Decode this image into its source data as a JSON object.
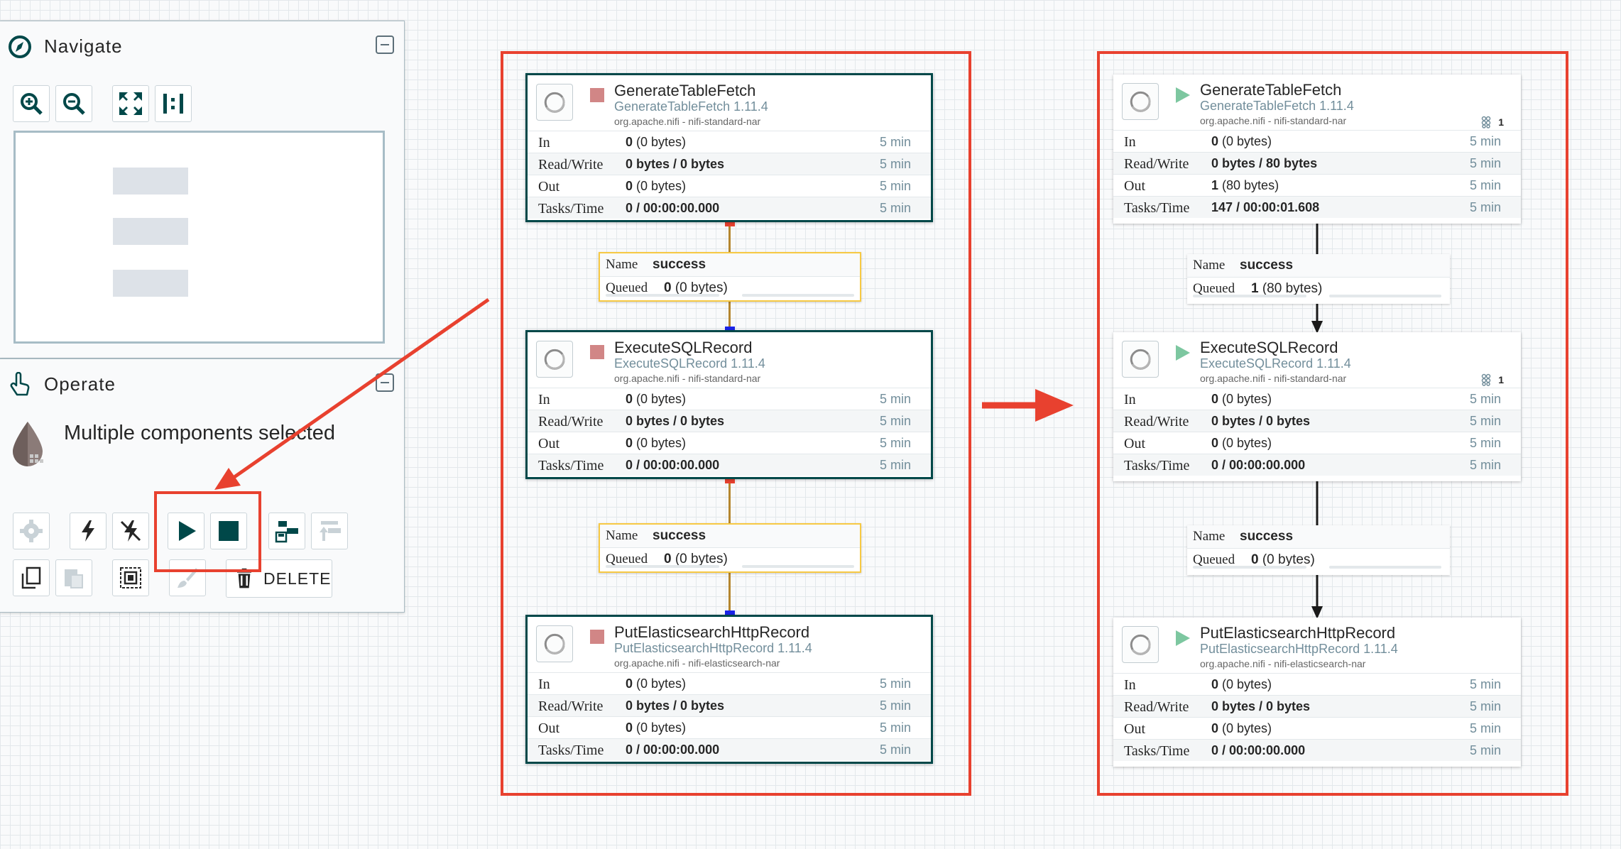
{
  "navigate": {
    "title": "Navigate"
  },
  "operate": {
    "title": "Operate",
    "selection_text": "Multiple components selected",
    "delete_label": "DELETE"
  },
  "icons": {
    "navigate": "compass-icon",
    "zoom_in": "zoom-in-icon",
    "zoom_out": "zoom-out-icon",
    "fit": "fit-screen-icon",
    "actual_size": "actual-size-icon",
    "operate": "pointer-hand-icon",
    "configure": "gear-icon",
    "enable": "lightning-icon",
    "disable": "lightning-off-icon",
    "start": "play-icon",
    "stop": "stop-icon",
    "template_create": "template-save-icon",
    "template_upload": "template-upload-icon",
    "copy": "copy-icon",
    "paste": "paste-icon",
    "group": "group-icon",
    "color": "paint-brush-icon",
    "delete": "trash-icon"
  },
  "colors": {
    "accent_red": "#e8412f",
    "selection_border": "#004849",
    "running_green": "#7dc7a0",
    "stopped_red": "#d18686",
    "label_border": "#f7c943"
  },
  "left_flow": {
    "processors": [
      {
        "name": "GenerateTableFetch",
        "type": "GenerateTableFetch 1.11.4",
        "bundle": "org.apache.nifi - nifi-standard-nar",
        "state": "stopped",
        "in_count": "0",
        "in_size": "(0 bytes)",
        "in_time": "5 min",
        "rw": "0 bytes / 0 bytes",
        "rw_time": "5 min",
        "out_count": "0",
        "out_size": "(0 bytes)",
        "out_time": "5 min",
        "tasks": "0 / 00:00:00.000",
        "tasks_time": "5 min"
      },
      {
        "name": "ExecuteSQLRecord",
        "type": "ExecuteSQLRecord 1.11.4",
        "bundle": "org.apache.nifi - nifi-standard-nar",
        "state": "stopped",
        "in_count": "0",
        "in_size": "(0 bytes)",
        "in_time": "5 min",
        "rw": "0 bytes / 0 bytes",
        "rw_time": "5 min",
        "out_count": "0",
        "out_size": "(0 bytes)",
        "out_time": "5 min",
        "tasks": "0 / 00:00:00.000",
        "tasks_time": "5 min"
      },
      {
        "name": "PutElasticsearchHttpRecord",
        "type": "PutElasticsearchHttpRecord 1.11.4",
        "bundle": "org.apache.nifi - nifi-elasticsearch-nar",
        "state": "stopped",
        "in_count": "0",
        "in_size": "(0 bytes)",
        "in_time": "5 min",
        "rw": "0 bytes / 0 bytes",
        "rw_time": "5 min",
        "out_count": "0",
        "out_size": "(0 bytes)",
        "out_time": "5 min",
        "tasks": "0 / 00:00:00.000",
        "tasks_time": "5 min"
      }
    ],
    "connections": [
      {
        "name_label": "Name",
        "name": "success",
        "queued_label": "Queued",
        "queued_count": "0",
        "queued_size": "(0 bytes)"
      },
      {
        "name_label": "Name",
        "name": "success",
        "queued_label": "Queued",
        "queued_count": "0",
        "queued_size": "(0 bytes)"
      }
    ]
  },
  "right_flow": {
    "processors": [
      {
        "name": "GenerateTableFetch",
        "type": "GenerateTableFetch 1.11.4",
        "bundle": "org.apache.nifi - nifi-standard-nar",
        "state": "running",
        "threads": "1",
        "in_count": "0",
        "in_size": "(0 bytes)",
        "in_time": "5 min",
        "rw": "0 bytes / 80 bytes",
        "rw_time": "5 min",
        "out_count": "1",
        "out_size": "(80 bytes)",
        "out_time": "5 min",
        "tasks": "147 / 00:00:01.608",
        "tasks_time": "5 min"
      },
      {
        "name": "ExecuteSQLRecord",
        "type": "ExecuteSQLRecord 1.11.4",
        "bundle": "org.apache.nifi - nifi-standard-nar",
        "state": "running",
        "threads": "1",
        "in_count": "0",
        "in_size": "(0 bytes)",
        "in_time": "5 min",
        "rw": "0 bytes / 0 bytes",
        "rw_time": "5 min",
        "out_count": "0",
        "out_size": "(0 bytes)",
        "out_time": "5 min",
        "tasks": "0 / 00:00:00.000",
        "tasks_time": "5 min"
      },
      {
        "name": "PutElasticsearchHttpRecord",
        "type": "PutElasticsearchHttpRecord 1.11.4",
        "bundle": "org.apache.nifi - nifi-elasticsearch-nar",
        "state": "running",
        "in_count": "0",
        "in_size": "(0 bytes)",
        "in_time": "5 min",
        "rw": "0 bytes / 0 bytes",
        "rw_time": "5 min",
        "out_count": "0",
        "out_size": "(0 bytes)",
        "out_time": "5 min",
        "tasks": "0 / 00:00:00.000",
        "tasks_time": "5 min"
      }
    ],
    "connections": [
      {
        "name_label": "Name",
        "name": "success",
        "queued_label": "Queued",
        "queued_count": "1",
        "queued_size": "(80 bytes)"
      },
      {
        "name_label": "Name",
        "name": "success",
        "queued_label": "Queued",
        "queued_count": "0",
        "queued_size": "(0 bytes)"
      }
    ]
  },
  "stat_labels": {
    "in": "In",
    "rw": "Read/Write",
    "out": "Out",
    "tasks": "Tasks/Time"
  }
}
